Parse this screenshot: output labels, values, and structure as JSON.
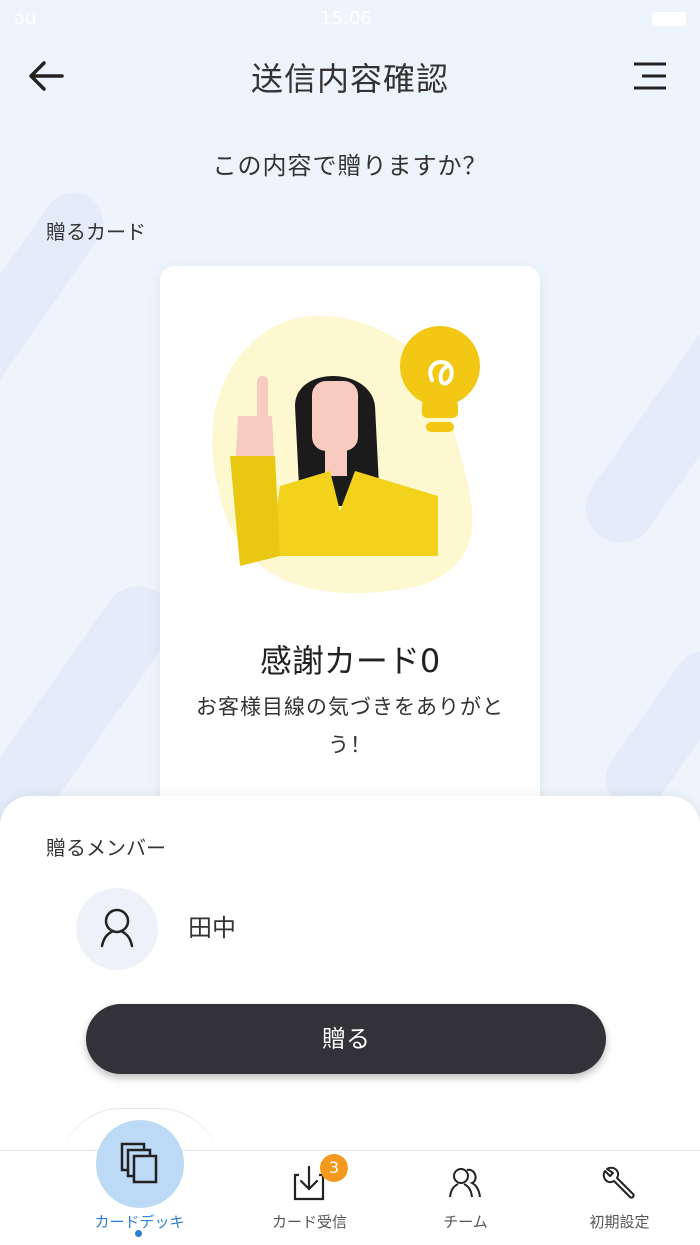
{
  "status_bar": {
    "carrier": "au",
    "time": "15:06"
  },
  "header": {
    "title": "送信内容確認"
  },
  "confirm_question": "この内容で贈りますか？",
  "card_section": {
    "label": "贈るカード",
    "card_title": "感謝カード0",
    "card_description": "お客様目線の気づきをありがとう！"
  },
  "member_section": {
    "label": "贈るメンバー",
    "members": [
      {
        "name": "田中"
      }
    ]
  },
  "send_button_label": "贈る",
  "tabbar": {
    "tabs": [
      {
        "label": "カードデッキ",
        "icon": "card-deck-icon",
        "active": true
      },
      {
        "label": "カード受信",
        "icon": "card-receive-icon",
        "badge": "3"
      },
      {
        "label": "チーム",
        "icon": "team-icon"
      },
      {
        "label": "初期設定",
        "icon": "wrench-icon"
      }
    ]
  },
  "colors": {
    "accent_blue": "#2f7fd0",
    "button_dark": "#323238",
    "badge_orange": "#f39a1e",
    "illustration_yellow": "#f2d21b"
  }
}
